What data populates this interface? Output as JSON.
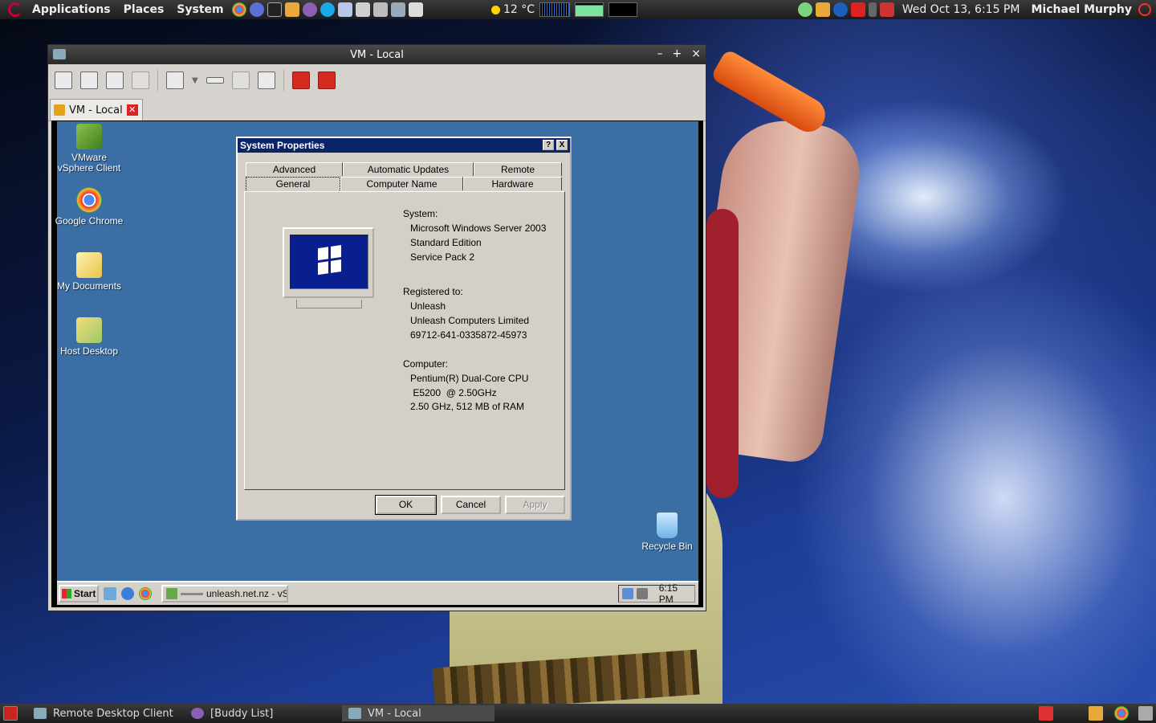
{
  "top_panel": {
    "menus": [
      "Applications",
      "Places",
      "System"
    ],
    "weather": "12 °C",
    "datetime": "Wed Oct 13,  6:15 PM",
    "user": "Michael Murphy"
  },
  "vm_window": {
    "title": "VM - Local",
    "tab_label": "VM - Local"
  },
  "guest": {
    "desktop_icons": [
      {
        "label": "VMware vSphere Client"
      },
      {
        "label": "Google Chrome"
      },
      {
        "label": "My Documents"
      },
      {
        "label": "Host Desktop"
      },
      {
        "label": "Recycle Bin"
      }
    ],
    "taskbar": {
      "start_label": "Start",
      "task_label": "unleash.net.nz - vS...",
      "clock": "6:15 PM"
    }
  },
  "system_properties": {
    "title": "System Properties",
    "help_btn": "?",
    "close_btn": "X",
    "tabs_row1": [
      "Advanced",
      "Automatic Updates",
      "Remote"
    ],
    "tabs_row2": [
      "General",
      "Computer Name",
      "Hardware"
    ],
    "system_heading": "System:",
    "system_lines": [
      "Microsoft Windows Server 2003",
      "Standard Edition",
      "Service Pack 2"
    ],
    "registered_heading": "Registered to:",
    "registered_lines": [
      "Unleash",
      "Unleash Computers Limited",
      "69712-641-0335872-45973"
    ],
    "computer_heading": "Computer:",
    "computer_lines": [
      "Pentium(R) Dual-Core  CPU",
      " E5200  @ 2.50GHz",
      "2.50 GHz, 512 MB of RAM"
    ],
    "buttons": {
      "ok": "OK",
      "cancel": "Cancel",
      "apply": "Apply"
    }
  },
  "bottom_panel": {
    "tasks": [
      "Remote Desktop Client",
      "[Buddy List]",
      "VM - Local"
    ]
  }
}
